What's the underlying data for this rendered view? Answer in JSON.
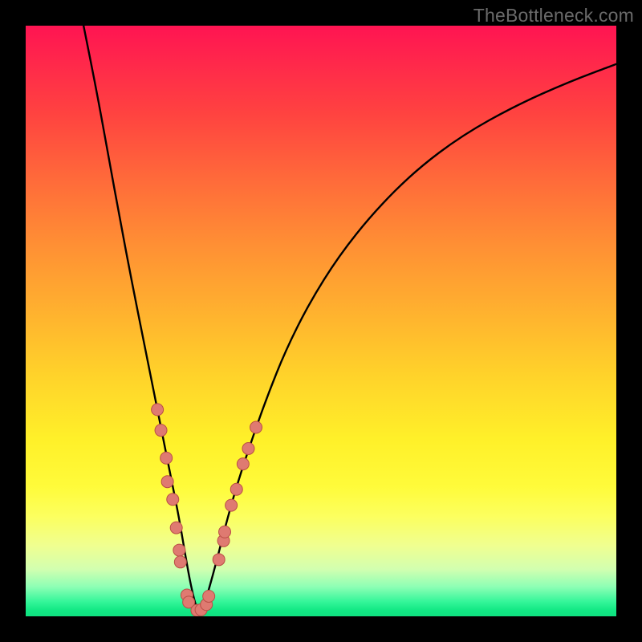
{
  "watermark": "TheBottleneck.com",
  "colors": {
    "curve": "#000000",
    "dot_fill": "#df7a71",
    "dot_stroke": "#b94e45",
    "frame": "#000000"
  },
  "chart_data": {
    "type": "line",
    "title": "",
    "xlabel": "",
    "ylabel": "",
    "xlim": [
      0,
      100
    ],
    "ylim": [
      0,
      100
    ],
    "note": "V-shaped bottleneck curve; minimum near x≈29. Axes are unlabeled; values estimated from pixel positions on a 0–100 grid.",
    "series": [
      {
        "name": "bottleneck-curve",
        "x": [
          9.8,
          12,
          14,
          16,
          18,
          20,
          21.5,
          23,
          24.5,
          26,
          27,
          28,
          29,
          30,
          31,
          32.5,
          34,
          36,
          38.5,
          41,
          44,
          48,
          53,
          59,
          66,
          74,
          83,
          92,
          100
        ],
        "y": [
          100,
          89,
          78,
          67,
          56.5,
          46.5,
          39,
          31.5,
          24,
          16.5,
          10.5,
          5,
          1,
          1.2,
          4.5,
          10,
          16,
          23,
          30.5,
          37.5,
          45,
          53,
          61,
          68.5,
          75.5,
          81.5,
          86.5,
          90.5,
          93.5
        ]
      }
    ],
    "dots": {
      "name": "scatter-points",
      "points": [
        {
          "x": 22.3,
          "y": 35.0
        },
        {
          "x": 22.9,
          "y": 31.5
        },
        {
          "x": 23.8,
          "y": 26.8
        },
        {
          "x": 24.0,
          "y": 22.8
        },
        {
          "x": 24.9,
          "y": 19.8
        },
        {
          "x": 25.5,
          "y": 15.0
        },
        {
          "x": 26.0,
          "y": 11.2
        },
        {
          "x": 26.2,
          "y": 9.2
        },
        {
          "x": 27.3,
          "y": 3.6
        },
        {
          "x": 27.6,
          "y": 2.4
        },
        {
          "x": 29.0,
          "y": 1.0
        },
        {
          "x": 29.7,
          "y": 1.1
        },
        {
          "x": 30.6,
          "y": 2.0
        },
        {
          "x": 31.0,
          "y": 3.4
        },
        {
          "x": 32.7,
          "y": 9.6
        },
        {
          "x": 33.5,
          "y": 12.8
        },
        {
          "x": 33.7,
          "y": 14.3
        },
        {
          "x": 34.8,
          "y": 18.8
        },
        {
          "x": 35.7,
          "y": 21.5
        },
        {
          "x": 36.8,
          "y": 25.8
        },
        {
          "x": 37.7,
          "y": 28.4
        },
        {
          "x": 39.0,
          "y": 32.0
        }
      ],
      "radius": 7.5
    }
  }
}
